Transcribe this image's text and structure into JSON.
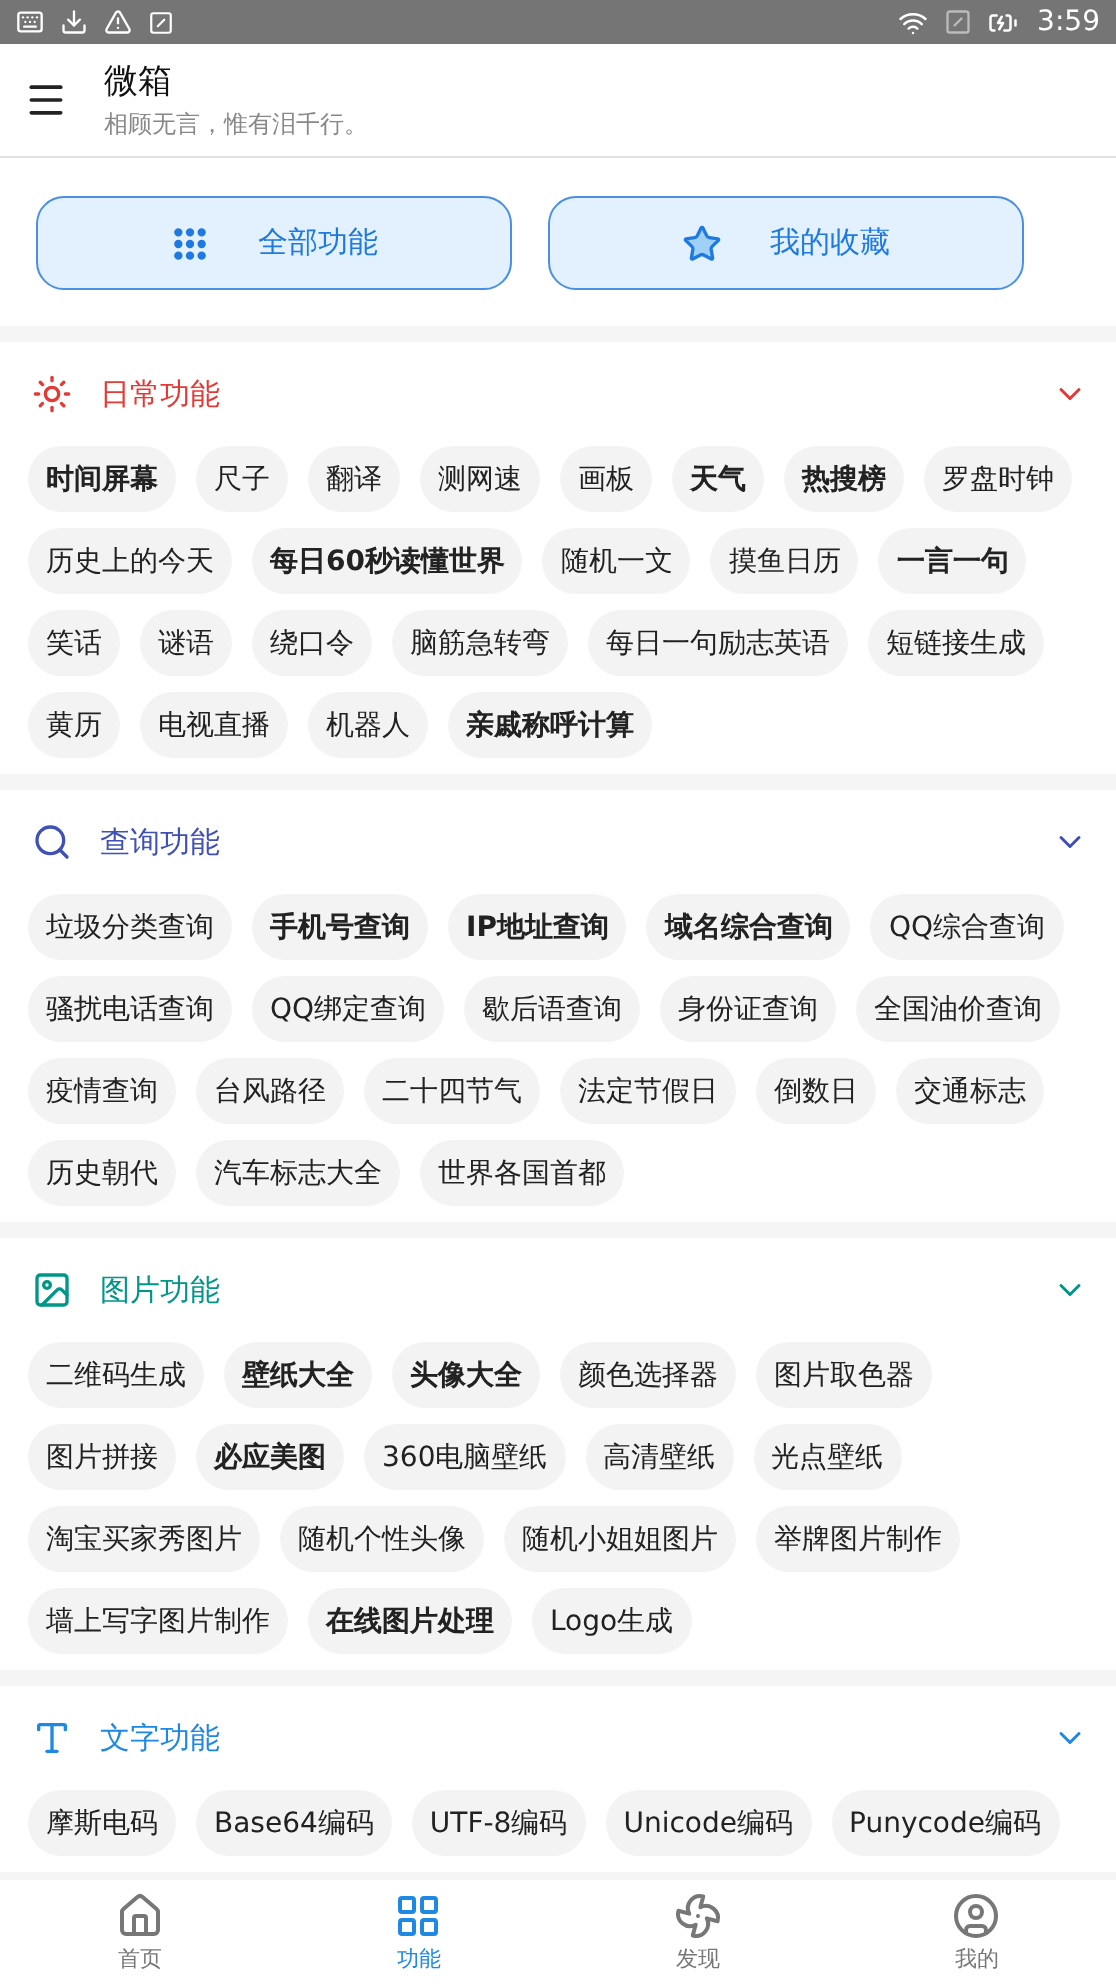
{
  "status_bar": {
    "time": "3:59"
  },
  "app_bar": {
    "title": "微箱",
    "subtitle": "相顾无言，惟有泪千行。"
  },
  "quick_buttons": [
    {
      "kind": "grid",
      "label": "全部功能"
    },
    {
      "kind": "star",
      "label": "我的收藏"
    }
  ],
  "sections": [
    {
      "kind": "sun",
      "title": "日常功能",
      "color": "#e53935",
      "expanded": true,
      "items": [
        {
          "label": "时间屏幕",
          "highlighted": true
        },
        {
          "label": "尺子",
          "highlighted": false
        },
        {
          "label": "翻译",
          "highlighted": false
        },
        {
          "label": "测网速",
          "highlighted": false
        },
        {
          "label": "画板",
          "highlighted": false
        },
        {
          "label": "天气",
          "highlighted": true
        },
        {
          "label": "热搜榜",
          "highlighted": true
        },
        {
          "label": "罗盘时钟",
          "highlighted": false
        },
        {
          "label": "历史上的今天",
          "highlighted": false
        },
        {
          "label": "每日60秒读懂世界",
          "highlighted": true
        },
        {
          "label": "随机一文",
          "highlighted": false
        },
        {
          "label": "摸鱼日历",
          "highlighted": false
        },
        {
          "label": "一言一句",
          "highlighted": true
        },
        {
          "label": "笑话",
          "highlighted": false
        },
        {
          "label": "谜语",
          "highlighted": false
        },
        {
          "label": "绕口令",
          "highlighted": false
        },
        {
          "label": "脑筋急转弯",
          "highlighted": false
        },
        {
          "label": "每日一句励志英语",
          "highlighted": false
        },
        {
          "label": "短链接生成",
          "highlighted": false
        },
        {
          "label": "黄历",
          "highlighted": false
        },
        {
          "label": "电视直播",
          "highlighted": false
        },
        {
          "label": "机器人",
          "highlighted": false
        },
        {
          "label": "亲戚称呼计算",
          "highlighted": true
        }
      ]
    },
    {
      "kind": "search",
      "title": "查询功能",
      "color": "#3f51b5",
      "expanded": true,
      "items": [
        {
          "label": "垃圾分类查询",
          "highlighted": false
        },
        {
          "label": "手机号查询",
          "highlighted": true
        },
        {
          "label": "IP地址查询",
          "highlighted": true
        },
        {
          "label": "域名综合查询",
          "highlighted": true
        },
        {
          "label": "QQ综合查询",
          "highlighted": false
        },
        {
          "label": "骚扰电话查询",
          "highlighted": false
        },
        {
          "label": "QQ绑定查询",
          "highlighted": false
        },
        {
          "label": "歇后语查询",
          "highlighted": false
        },
        {
          "label": "身份证查询",
          "highlighted": false
        },
        {
          "label": "全国油价查询",
          "highlighted": false
        },
        {
          "label": "疫情查询",
          "highlighted": false
        },
        {
          "label": "台风路径",
          "highlighted": false
        },
        {
          "label": "二十四节气",
          "highlighted": false
        },
        {
          "label": "法定节假日",
          "highlighted": false
        },
        {
          "label": "倒数日",
          "highlighted": false
        },
        {
          "label": "交通标志",
          "highlighted": false
        },
        {
          "label": "历史朝代",
          "highlighted": false
        },
        {
          "label": "汽车标志大全",
          "highlighted": false
        },
        {
          "label": "世界各国首都",
          "highlighted": false
        }
      ]
    },
    {
      "kind": "image",
      "title": "图片功能",
      "color": "#009688",
      "expanded": true,
      "items": [
        {
          "label": "二维码生成",
          "highlighted": false
        },
        {
          "label": "壁纸大全",
          "highlighted": true
        },
        {
          "label": "头像大全",
          "highlighted": true
        },
        {
          "label": "颜色选择器",
          "highlighted": false
        },
        {
          "label": "图片取色器",
          "highlighted": false
        },
        {
          "label": "图片拼接",
          "highlighted": false
        },
        {
          "label": "必应美图",
          "highlighted": true
        },
        {
          "label": "360电脑壁纸",
          "highlighted": false
        },
        {
          "label": "高清壁纸",
          "highlighted": false
        },
        {
          "label": "光点壁纸",
          "highlighted": false
        },
        {
          "label": "淘宝买家秀图片",
          "highlighted": false
        },
        {
          "label": "随机个性头像",
          "highlighted": false
        },
        {
          "label": "随机小姐姐图片",
          "highlighted": false
        },
        {
          "label": "举牌图片制作",
          "highlighted": false
        },
        {
          "label": "墙上写字图片制作",
          "highlighted": false
        },
        {
          "label": "在线图片处理",
          "highlighted": true
        },
        {
          "label": "Logo生成",
          "highlighted": false
        }
      ]
    },
    {
      "kind": "text",
      "title": "文字功能",
      "color": "#1e88e5",
      "expanded": true,
      "items": [
        {
          "label": "摩斯电码",
          "highlighted": false
        },
        {
          "label": "Base64编码",
          "highlighted": false
        },
        {
          "label": "UTF-8编码",
          "highlighted": false
        },
        {
          "label": "Unicode编码",
          "highlighted": false
        },
        {
          "label": "Punycode编码",
          "highlighted": false
        }
      ]
    }
  ],
  "bottom_nav": [
    {
      "kind": "home",
      "label": "首页",
      "selected": false
    },
    {
      "kind": "grid",
      "label": "功能",
      "selected": true
    },
    {
      "kind": "pinwheel",
      "label": "发现",
      "selected": false
    },
    {
      "kind": "user",
      "label": "我的",
      "selected": false
    }
  ]
}
